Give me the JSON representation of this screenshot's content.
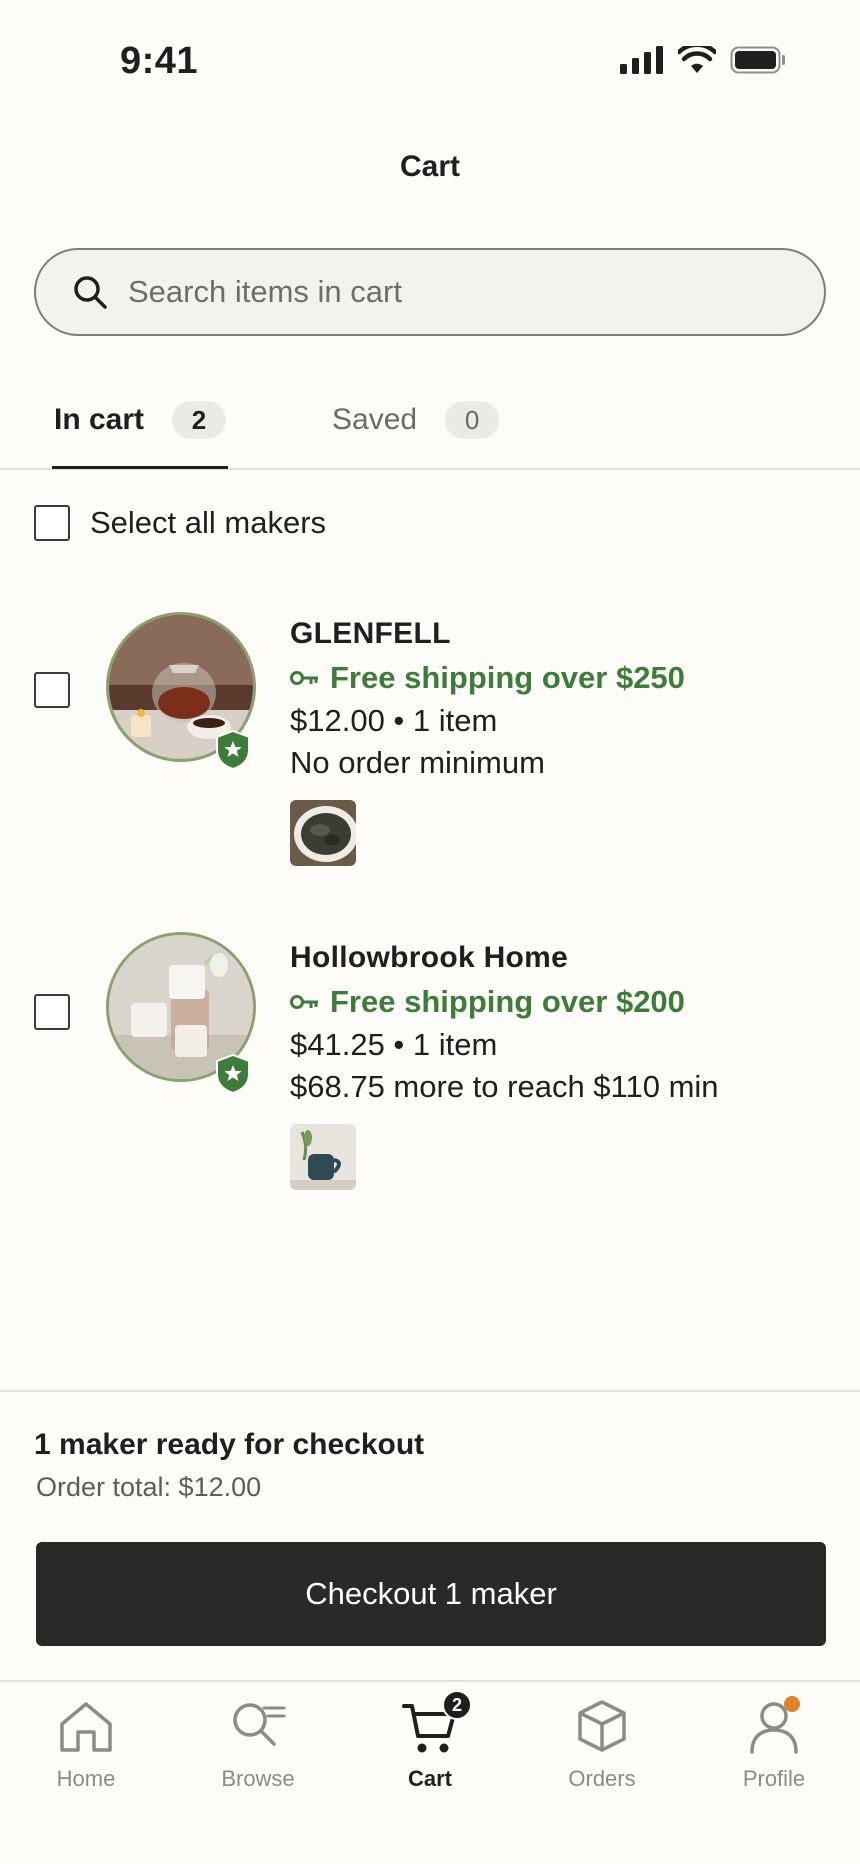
{
  "status_bar": {
    "time": "9:41"
  },
  "header": {
    "title": "Cart"
  },
  "search": {
    "placeholder": "Search items in cart"
  },
  "tabs": [
    {
      "label": "In cart",
      "count": "2",
      "active": true
    },
    {
      "label": "Saved",
      "count": "0",
      "active": false
    }
  ],
  "select_all": {
    "label": "Select all makers"
  },
  "makers": [
    {
      "name": "GLENFELL",
      "shipping": "Free shipping over $250",
      "price_line": "$12.00 • 1 item",
      "minimum_line": "No order minimum",
      "product_thumb": "loose-leaf-tea-bowl"
    },
    {
      "name": "Hollowbrook Home",
      "shipping": "Free shipping over $200",
      "price_line": "$41.25 • 1 item",
      "minimum_line": "$68.75 more to reach $110 min",
      "product_thumb": "teal-ceramic-mug"
    }
  ],
  "summary": {
    "title": "1 maker ready for checkout",
    "total": "Order total: $12.00",
    "checkout_label": "Checkout 1 maker"
  },
  "tabbar": {
    "items": [
      {
        "label": "Home",
        "icon": "home-icon"
      },
      {
        "label": "Browse",
        "icon": "browse-icon"
      },
      {
        "label": "Cart",
        "icon": "cart-icon",
        "badge": "2",
        "active": true
      },
      {
        "label": "Orders",
        "icon": "box-icon"
      },
      {
        "label": "Profile",
        "icon": "person-icon"
      }
    ]
  },
  "colors": {
    "background": "#FDFCF8",
    "accent_green": "#3E7C3A",
    "button_dark": "#2b2927",
    "notification_orange": "#E0822B"
  }
}
